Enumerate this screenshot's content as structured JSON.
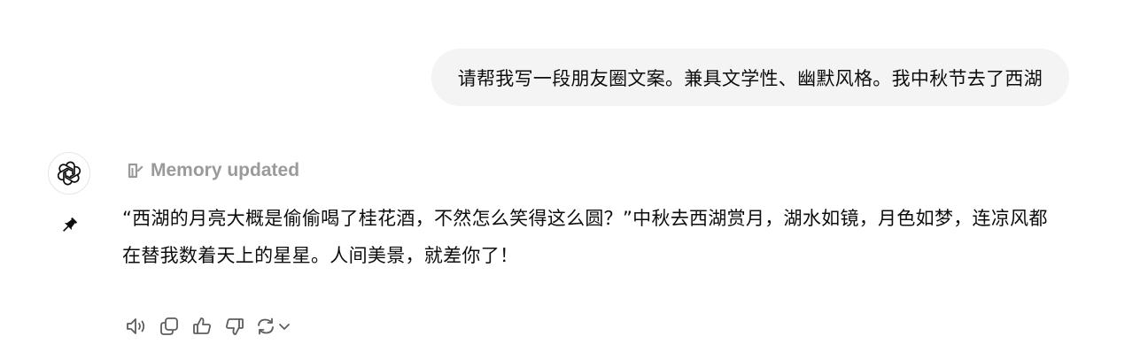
{
  "user_message": {
    "text": "请帮我写一段朋友圈文案。兼具文学性、幽默风格。我中秋节去了西湖"
  },
  "assistant_message": {
    "memory_label": "Memory updated",
    "text": "“西湖的月亮大概是偷偷喝了桂花酒，不然怎么笑得这么圆？”中秋去西湖赏月，湖水如镜，月色如梦，连凉风都在替我数着天上的星星。人间美景，就差你了！"
  },
  "actions": {
    "icons": [
      "read-aloud-icon",
      "copy-icon",
      "thumbs-up-icon",
      "thumbs-down-icon",
      "regenerate-icon",
      "chevron-down-icon"
    ]
  },
  "colors": {
    "bubble_bg": "#f4f4f4",
    "muted_text": "#9a9a9a",
    "icon_color": "#5d5d5d"
  }
}
